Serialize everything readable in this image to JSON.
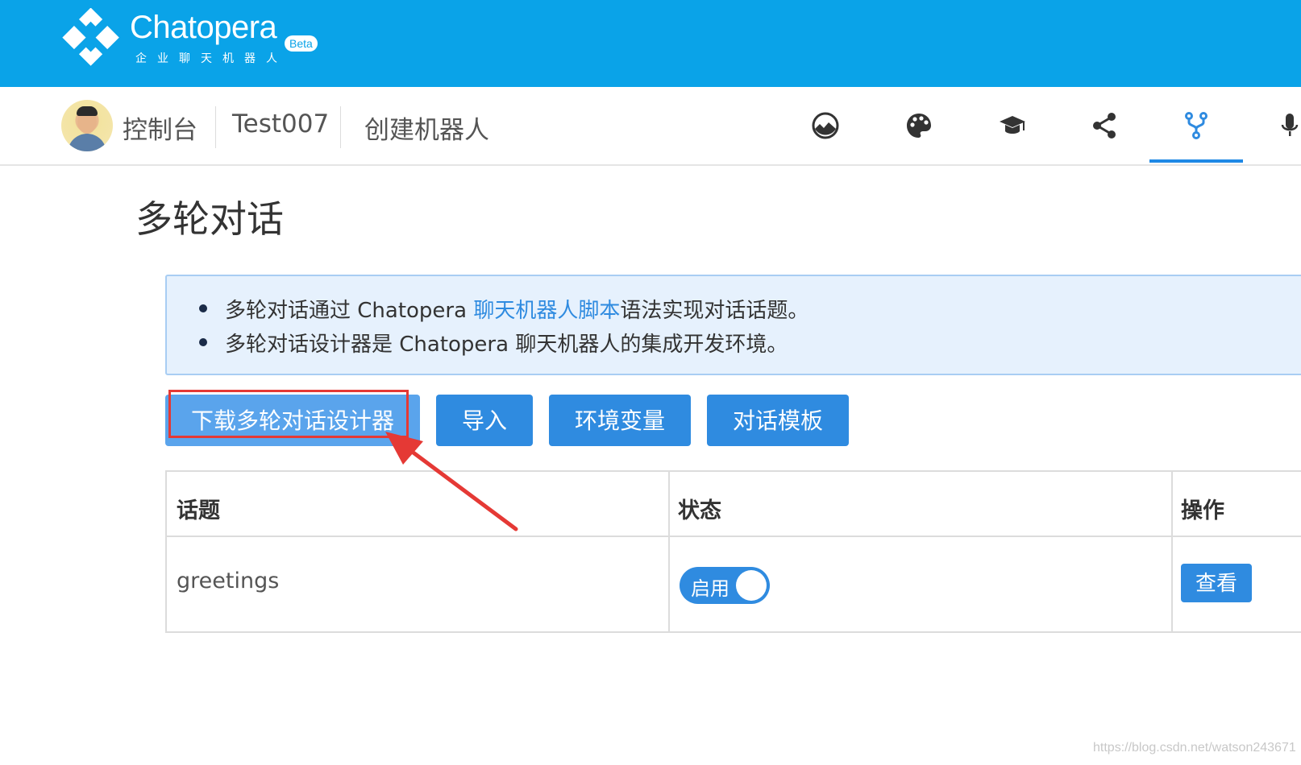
{
  "brand": {
    "name": "Chatopera",
    "subtitle": "企业聊天机器人",
    "badge": "Beta",
    "color": "#0aa3e8"
  },
  "nav": {
    "console": "控制台",
    "bot_name": "Test007",
    "create_bot": "创建机器人",
    "icons": [
      "dashboard-icon",
      "palette-icon",
      "graduation-cap-icon",
      "share-icon",
      "fork-icon",
      "microphone-icon"
    ],
    "active_icon": "fork-icon"
  },
  "page": {
    "title": "多轮对话"
  },
  "info": {
    "line1_prefix": "多轮对话通过 Chatopera ",
    "line1_link": "聊天机器人脚本",
    "line1_suffix": "语法实现对话话题。",
    "line2": "多轮对话设计器是 Chatopera 聊天机器人的集成开发环境。"
  },
  "actions": {
    "download": "下载多轮对话设计器",
    "import": "导入",
    "env_vars": "环境变量",
    "templates": "对话模板"
  },
  "table": {
    "headers": [
      "话题",
      "状态",
      "操作"
    ],
    "rows": [
      {
        "topic": "greetings",
        "status": "启用",
        "enabled": true,
        "action": "查看"
      }
    ]
  },
  "watermark": "https://blog.csdn.net/watson243671",
  "colors": {
    "primary": "#2f8be0",
    "highlight": "#e53935",
    "info_bg": "#e6f1fd"
  }
}
